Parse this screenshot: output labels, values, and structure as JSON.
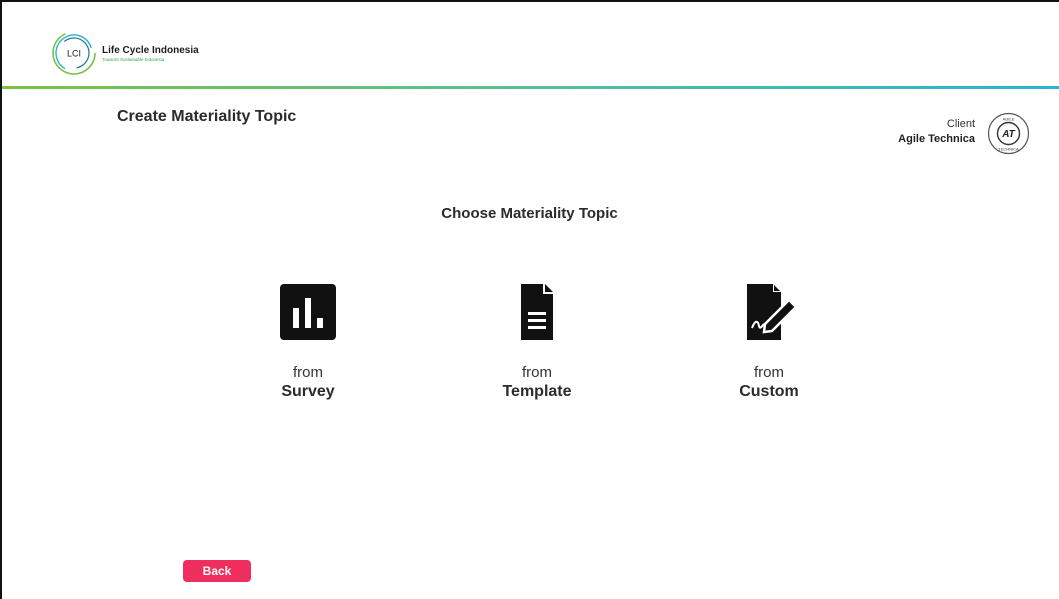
{
  "header": {
    "logo_abbr": "LCI",
    "brand_name": "Life Cycle Indonesia",
    "brand_tagline": "Towards Sustainable Indonesia"
  },
  "page": {
    "title": "Create Materiality Topic"
  },
  "client": {
    "label": "Client",
    "name": "Agile Technica",
    "logo_text": "AT",
    "logo_ring_top": "AGILE",
    "logo_ring_bottom": "TECHNICA"
  },
  "chooser": {
    "title": "Choose Materiality Topic",
    "options": [
      {
        "from": "from",
        "kind": "Survey",
        "icon": "bar-chart-icon"
      },
      {
        "from": "from",
        "kind": "Template",
        "icon": "document-icon"
      },
      {
        "from": "from",
        "kind": "Custom",
        "icon": "signature-edit-icon"
      }
    ]
  },
  "footer": {
    "back_label": "Back"
  },
  "colors": {
    "accent_green": "#7ac043",
    "accent_blue": "#2bb3d6",
    "back_button": "#ee2e5e"
  }
}
